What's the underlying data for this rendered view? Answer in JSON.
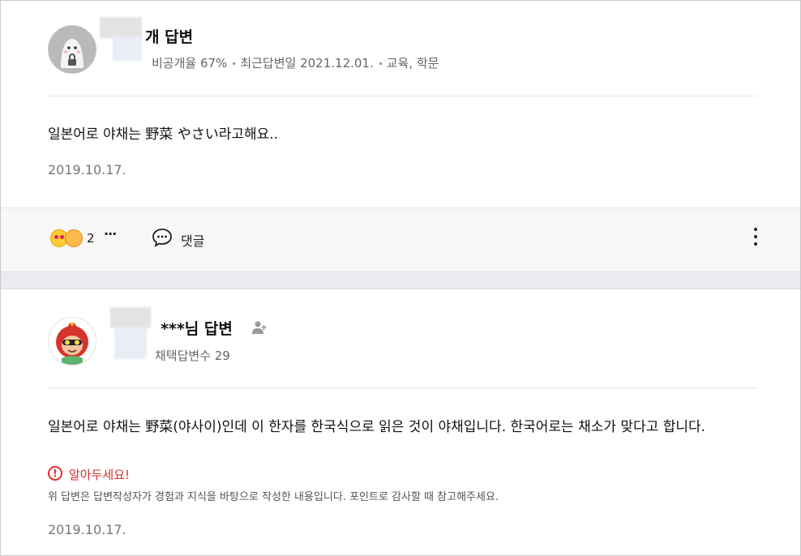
{
  "answer1": {
    "title": "개 답변",
    "meta_private": "비공개율 67%",
    "meta_recent": "최근답변일 2021.12.01.",
    "meta_category": "교육, 학문",
    "body": "일본어로 야채는 野菜 やさい라고해요..",
    "date": "2019.10.17."
  },
  "reactions": {
    "count": "2",
    "more": "···",
    "comment_label": "댓글",
    "icons": [
      "heart-eyes-emoji",
      "shy-emoji",
      "speech-bubble-icon",
      "vertical-dots-icon"
    ]
  },
  "answer2": {
    "title": "***님 답변",
    "meta": "채택답변수 29",
    "body": "일본어로 야채는 野菜(야사이)인데 이 한자를 한국식으로 읽은 것이 야채입니다. 한국어로는 채소가 맞다고 합니다.",
    "notice_title": "알아두세요!",
    "notice_text": "위 답변은 답변작성자가 경험과 지식을 바탕으로 작성한 내용입니다. 포인트로 감사할 때 참고해주세요.",
    "date": "2019.10.17."
  },
  "colors": {
    "notice": "#d6302f",
    "bar_bg": "#f7f7f7",
    "gap_bg": "#e9ebef"
  }
}
